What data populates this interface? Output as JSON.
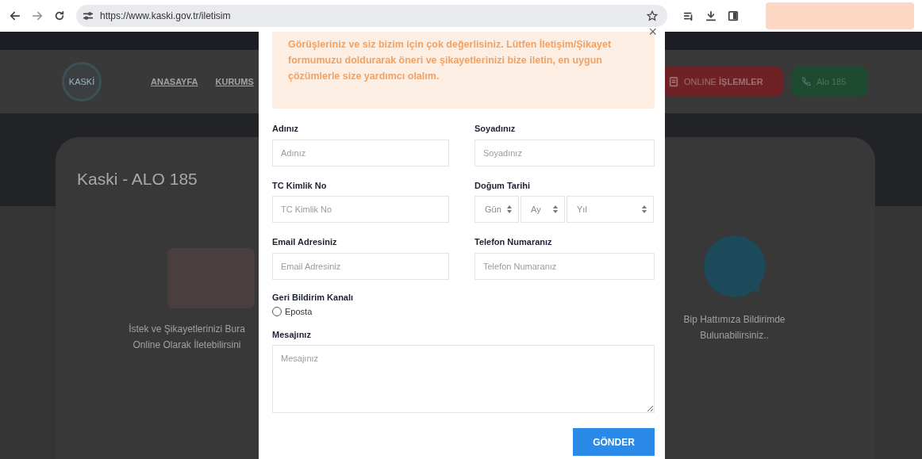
{
  "browser": {
    "url": "https://www.kaski.gov.tr/iletisim"
  },
  "site": {
    "logo_text": "KASKİ",
    "nav": [
      "ANASAYFA",
      "KURUMS"
    ],
    "header_buttons": [
      {
        "kind": "online",
        "label": "ONLINE **İŞLEMLER**"
      },
      {
        "kind": "phone",
        "label": "Alo 185"
      }
    ],
    "page_title": "Kaski - ALO 185",
    "cards": [
      {
        "kind": "istek",
        "lines": [
          "İstek ve Şikayetlerinizi Bura",
          "Online Olarak İletebilirsini"
        ]
      },
      {
        "kind": "bip",
        "lines": [
          "Bip Hattımıza Bildirimde",
          "Bulunabilirsiniz.."
        ]
      }
    ]
  },
  "modal": {
    "close": "×",
    "intro": "Görüşleriniz ve siz bizim için çok değerlisiniz. Lütfen İletişim/Şikayet formumuzu doldurarak öneri ve şikayetlerinizi bize iletin, en uygun çözümlerle size yardımcı olalım.",
    "fields": [
      {
        "kind": "text",
        "label": "Adınız",
        "placeholder": "Adınız"
      },
      {
        "kind": "text",
        "label": "Soyadınız",
        "placeholder": "Soyadınız"
      },
      {
        "kind": "text",
        "label": "TC Kimlik No",
        "placeholder": "TC Kimlik No"
      },
      {
        "kind": "date",
        "label": "Doğum Tarihi",
        "selects": [
          "Gün",
          "Ay",
          "Yıl"
        ]
      },
      {
        "kind": "text",
        "label": "Email Adresiniz",
        "placeholder": "Email Adresiniz"
      },
      {
        "kind": "text",
        "label": "Telefon Numaranız",
        "placeholder": "Telefon Numaranız"
      },
      {
        "kind": "radio",
        "label": "Geri Bildirim Kanalı",
        "options": [
          {
            "label": "Eposta",
            "checked": false
          }
        ]
      },
      {
        "kind": "textarea",
        "label": "Mesajınız",
        "placeholder": "Mesajınız"
      }
    ],
    "submit": "GÖNDER"
  }
}
